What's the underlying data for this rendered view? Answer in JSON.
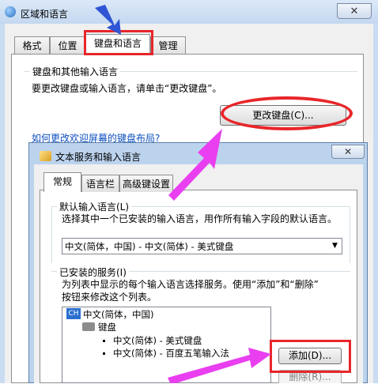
{
  "outer_dialog": {
    "title": "区域和语言",
    "close_label": "✕",
    "tabs": [
      {
        "label": "格式"
      },
      {
        "label": "位置"
      },
      {
        "label": "键盘和语言"
      },
      {
        "label": "管理"
      }
    ],
    "keyboard_group": {
      "label": "键盘和其他输入语言",
      "description": "要更改键盘或输入语言，请单击“更改键盘”。",
      "change_button": "更改键盘(C)...",
      "link": "如何更改欢迎屏幕的键盘布局?"
    }
  },
  "inner_dialog": {
    "title": "文本服务和输入语言",
    "close_label": "✕",
    "tabs": [
      {
        "label": "常规"
      },
      {
        "label": "语言栏"
      },
      {
        "label": "高级键设置"
      }
    ],
    "default_group": {
      "label": "默认输入语言(L)",
      "description": "选择其中一个已安装的输入语言，用作所有输入字段的默认语言。",
      "selected": "中文(简体，中国) - 中文(简体) - 美式键盘"
    },
    "installed_group": {
      "label": "已安装的服务(I)",
      "description_line1": "为列表中显示的每个输入语言选择服务。使用“添加”和“删除”",
      "description_line2": "按钮来修改这个列表。",
      "tree": {
        "language_badge": "CH",
        "language": "中文(简体，中国)",
        "category": "键盘",
        "items": [
          "中文(简体) - 美式键盘",
          "中文(简体) - 百度五笔输入法"
        ]
      },
      "add_button": "添加(D)...",
      "remove_button": "删除(R)..."
    }
  },
  "annotation_color": "#e8262a",
  "arrow_color": "#e93ff0"
}
